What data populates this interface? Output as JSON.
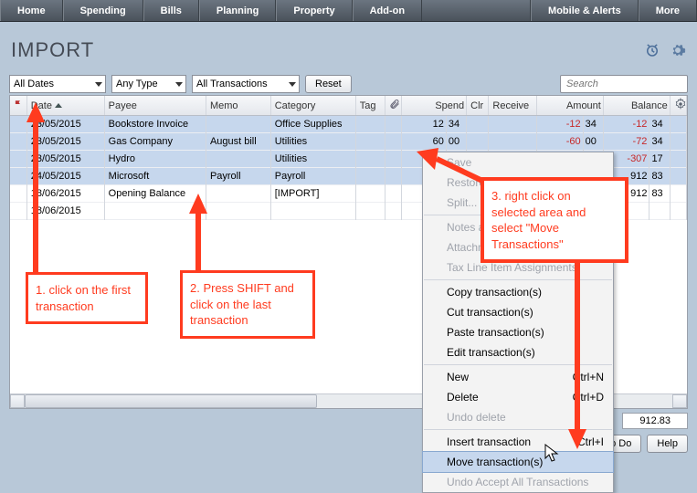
{
  "nav": {
    "home": "Home",
    "spending": "Spending",
    "bills": "Bills",
    "planning": "Planning",
    "property": "Property",
    "addon": "Add-on",
    "mobile": "Mobile & Alerts",
    "more": "More"
  },
  "title": "IMPORT",
  "filters": {
    "dates": "All Dates",
    "type": "Any Type",
    "txn": "All Transactions",
    "reset": "Reset",
    "search_placeholder": "Search"
  },
  "columns": {
    "flag": "",
    "date": "Date",
    "payee": "Payee",
    "memo": "Memo",
    "category": "Category",
    "tag": "Tag",
    "clip": "",
    "spend": "Spend",
    "clr": "Clr",
    "receive": "Receive",
    "amount": "Amount",
    "balance": "Balance"
  },
  "rows": [
    {
      "sel": true,
      "date": "23/05/2015",
      "payee": "Bookstore Invoice",
      "memo": "",
      "category": "Office Supplies",
      "spend_i": "12",
      "spend_c": "34",
      "amount_i": "-12",
      "amount_c": "34",
      "balance_i": "-12",
      "balance_c": "34",
      "neg": true
    },
    {
      "sel": true,
      "date": "23/05/2015",
      "payee": "Gas Company",
      "memo": "August bill",
      "category": "Utilities",
      "spend_i": "60",
      "spend_c": "00",
      "amount_i": "-60",
      "amount_c": "00",
      "balance_i": "-72",
      "balance_c": "34",
      "neg": true
    },
    {
      "sel": true,
      "date": "23/05/2015",
      "payee": "Hydro",
      "memo": "",
      "category": "Utilities",
      "spend_i": "",
      "spend_c": "",
      "amount_i": "",
      "amount_c": "",
      "balance_i": "-307",
      "balance_c": "17",
      "balpart": true,
      "neg": true,
      "amtpart": "3"
    },
    {
      "sel": true,
      "date": "24/05/2015",
      "payee": "Microsoft",
      "memo": "Payroll",
      "category": "Payroll",
      "spend_i": "",
      "spend_c": "",
      "balance_i": "912",
      "balance_c": "83",
      "amtpart": "0"
    },
    {
      "sel": false,
      "date": "18/06/2015",
      "payee": "Opening Balance",
      "memo": "",
      "category": "[IMPORT]",
      "balance_i": "912",
      "balance_c": "83"
    },
    {
      "sel": false,
      "date": "18/06/2015",
      "payee": "",
      "memo": "",
      "category": ""
    }
  ],
  "total": "912.83",
  "footer_buttons": {
    "todo": "o Do",
    "help": "Help"
  },
  "ctx": {
    "save": "Save",
    "restore": "Restore",
    "split": "Split...",
    "notes": "Notes an",
    "attach": "Attachm",
    "tax": "Tax Line Item Assignments",
    "copy": "Copy transaction(s)",
    "cut": "Cut transaction(s)",
    "paste": "Paste transaction(s)",
    "edit": "Edit transaction(s)",
    "new": "New",
    "new_s": "Ctrl+N",
    "delete": "Delete",
    "delete_s": "Ctrl+D",
    "undodel": "Undo delete",
    "insert": "Insert transaction",
    "insert_s": "Ctrl+I",
    "move": "Move transaction(s)",
    "undoacc": "Undo Accept All Transactions"
  },
  "anno": {
    "a1": "1. click on the first transaction",
    "a2": "2. Press SHIFT and click on the last transaction",
    "a3": "3. right click on selected area and select \"Move Transactions\""
  }
}
